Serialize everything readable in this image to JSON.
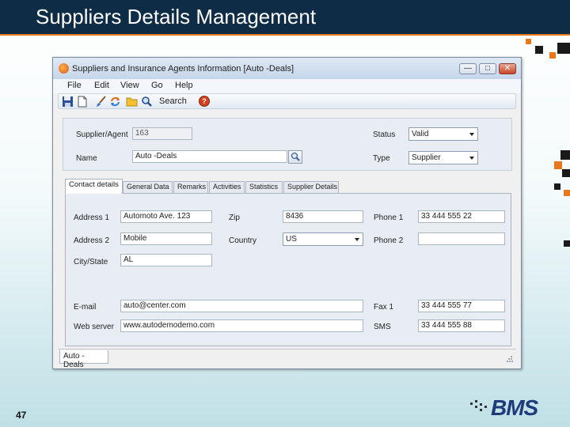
{
  "slide": {
    "title": "Suppliers Details Management",
    "page_number": "47",
    "logo_text": "BMS"
  },
  "window": {
    "title": "Suppliers and Insurance Agents Information [Auto -Deals]",
    "controls": {
      "minimize": "—",
      "maximize": "□",
      "close": "✕"
    }
  },
  "menu": [
    "File",
    "Edit",
    "View",
    "Go",
    "Help"
  ],
  "toolbar": {
    "icons": [
      "save-icon",
      "new-document-icon",
      "brush-icon",
      "refresh-icon",
      "folder-icon",
      "search-icon"
    ],
    "search_label": "Search",
    "help_symbol": "?"
  },
  "header": {
    "supplier_agent_label": "Supplier/Agent",
    "supplier_agent_value": "163",
    "name_label": "Name",
    "name_value": "Auto -Deals",
    "status_label": "Status",
    "status_value": "Valid",
    "type_label": "Type",
    "type_value": "Supplier"
  },
  "tabs": [
    "Contact details",
    "General Data",
    "Remarks",
    "Activities",
    "Statistics",
    "Supplier Details"
  ],
  "contact": {
    "address1_label": "Address 1",
    "address1_value": "Automoto Ave. 123",
    "address2_label": "Address 2",
    "address2_value": "Mobile",
    "city_label": "City/State",
    "city_value": "AL",
    "zip_label": "Zip",
    "zip_value": "8436",
    "country_label": "Country",
    "country_value": "US",
    "phone1_label": "Phone 1",
    "phone1_value": "33 444 555 22",
    "phone2_label": "Phone 2",
    "phone2_value": "",
    "email_label": "E-mail",
    "email_value": "auto@center.com",
    "web_label": "Web server",
    "web_value": "www.autodemodemo.com",
    "fax_label": "Fax 1",
    "fax_value": "33 444 555 77",
    "sms_label": "SMS",
    "sms_value": "33 444 555 88"
  },
  "bottom_tab": "Auto -Deals",
  "colors": {
    "header_band": "#0f2c47",
    "accent": "#e8781c",
    "logo": "#1f3a7a"
  }
}
